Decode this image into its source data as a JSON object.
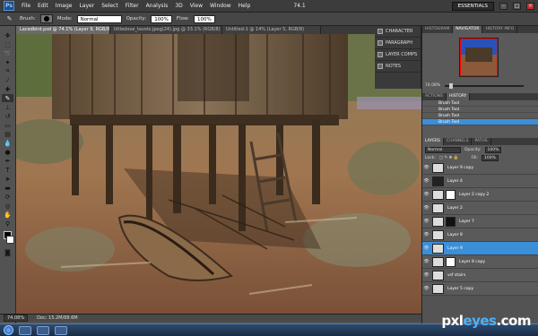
{
  "menubar": {
    "logo": "Ps",
    "items": [
      "File",
      "Edit",
      "Image",
      "Layer",
      "Select",
      "Filter",
      "Analysis",
      "3D",
      "View",
      "Window",
      "Help"
    ],
    "zoom": "74.1",
    "workspace": "ESSENTIALS"
  },
  "options": {
    "brush_label": "Brush:",
    "mode_label": "Mode:",
    "mode_value": "Normal",
    "opacity_label": "Opacity:",
    "opacity_value": "100%",
    "flow_label": "Flow:",
    "flow_value": "100%"
  },
  "tabs": [
    "Lacedbird.psd @ 74.1% (Layer 9, RGB/8) *",
    "littledove_tavolo.jpeg(24).jpg @ 33.1% (RGB/8)",
    "Untitled-1 @ 14% (Layer 5, RGB/8)"
  ],
  "dock": [
    "CHARACTER",
    "PARAGRAPH",
    "LAYER COMPS",
    "NOTES"
  ],
  "navigator": {
    "tabs": [
      "HISTOGRAM",
      "NAVIGATOR",
      "HISTORY INFO"
    ],
    "zoom": "74.08%"
  },
  "history": {
    "tabs": [
      "ACTIONS",
      "HISTORY"
    ],
    "rows": [
      "Brush Tool",
      "Brush Tool",
      "Brush Tool",
      "Brush Tool"
    ]
  },
  "layers": {
    "tabs": [
      "LAYERS",
      "CHANNELS",
      "PATHS"
    ],
    "blend": "Normal",
    "opacity_label": "Opacity:",
    "opacity_value": "100%",
    "lock_label": "Lock:",
    "fill_label": "Fill:",
    "fill_value": "100%",
    "rows": [
      {
        "name": "Layer 9 copy",
        "selected": false
      },
      {
        "name": "Layer 4",
        "selected": false
      },
      {
        "name": "Layer 2 copy 2",
        "selected": false
      },
      {
        "name": "Layer 2",
        "selected": false
      },
      {
        "name": "Layer 7",
        "selected": false
      },
      {
        "name": "Layer 8",
        "selected": false
      },
      {
        "name": "Layer 9",
        "selected": true
      },
      {
        "name": "Layer 8 copy",
        "selected": false
      },
      {
        "name": "vsf stairs",
        "selected": false
      },
      {
        "name": "Layer 5 copy",
        "selected": false
      }
    ]
  },
  "status": {
    "zoom": "74.08%",
    "doc": "Doc: 15.2M/88.6M"
  },
  "watermark": {
    "part1": "pxl",
    "part2": "eyes",
    "part3": ".com"
  }
}
